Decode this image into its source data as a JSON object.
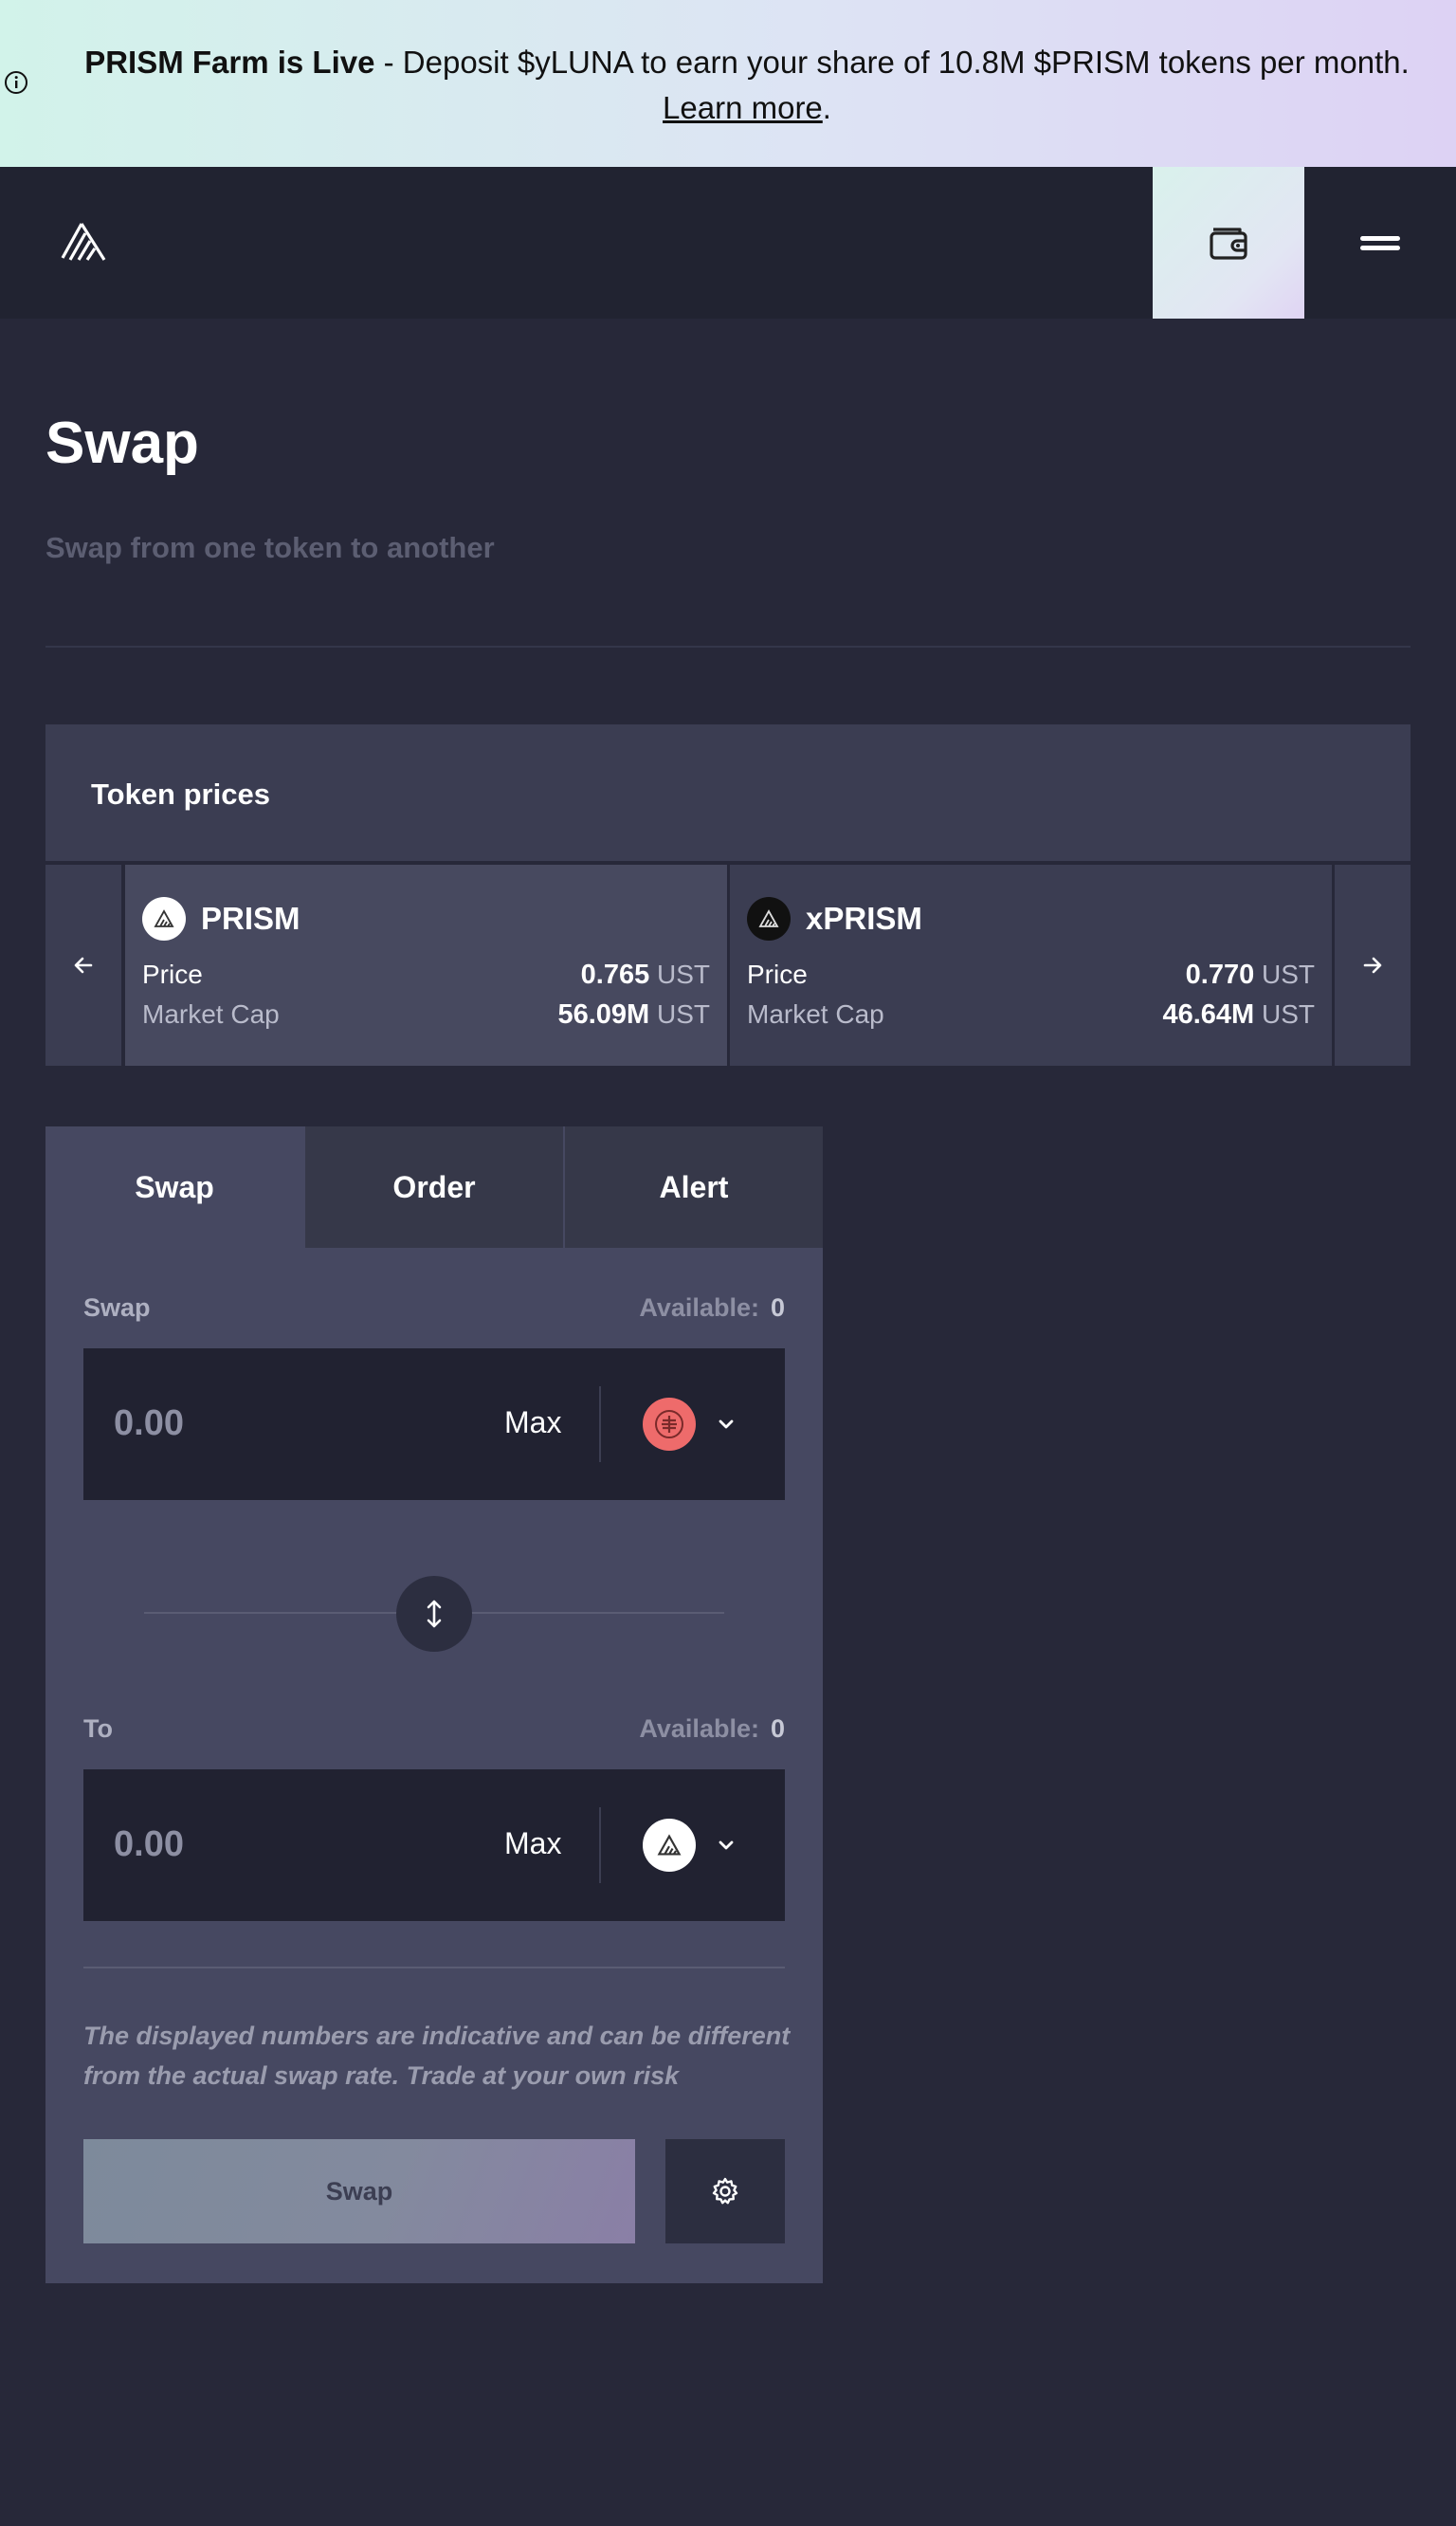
{
  "banner": {
    "title": "PRISM Farm is Live",
    "message": " - Deposit $yLUNA to earn your share of 10.8M $PRISM tokens per month. ",
    "link_label": "Learn more",
    "end": ".",
    "icon": "info-icon"
  },
  "header": {
    "logo_icon": "prism-logo-icon",
    "wallet_icon": "wallet-icon",
    "menu_icon": "hamburger-menu-icon"
  },
  "page": {
    "title": "Swap",
    "subtitle": "Swap from one token to another"
  },
  "token_prices": {
    "heading": "Token prices",
    "prev_icon": "arrow-left-icon",
    "next_icon": "arrow-right-icon",
    "cards": [
      {
        "name": "PRISM",
        "price_label": "Price",
        "price_value": "0.765",
        "price_unit": "UST",
        "mcap_label": "Market Cap",
        "mcap_value": "56.09M",
        "mcap_unit": "UST"
      },
      {
        "name": "xPRISM",
        "price_label": "Price",
        "price_value": "0.770",
        "price_unit": "UST",
        "mcap_label": "Market Cap",
        "mcap_value": "46.64M",
        "mcap_unit": "UST"
      }
    ]
  },
  "swap_panel": {
    "tabs": [
      "Swap",
      "Order",
      "Alert"
    ],
    "active_tab": "Swap",
    "from": {
      "label": "Swap",
      "available_label": "Available:",
      "available_value": "0",
      "amount_placeholder": "0.00",
      "max_label": "Max",
      "token_icon": "ust-coin-icon"
    },
    "to": {
      "label": "To",
      "available_label": "Available:",
      "available_value": "0",
      "amount_placeholder": "0.00",
      "max_label": "Max",
      "token_icon": "prism-coin-icon"
    },
    "disclaimer": "The displayed numbers are indicative and can be different from the actual swap rate. Trade at your own risk",
    "submit_label": "Swap",
    "settings_icon": "gear-icon"
  },
  "colors": {
    "background": "#272839",
    "panel": "#464861",
    "ust_red": "#ee6b6b"
  }
}
